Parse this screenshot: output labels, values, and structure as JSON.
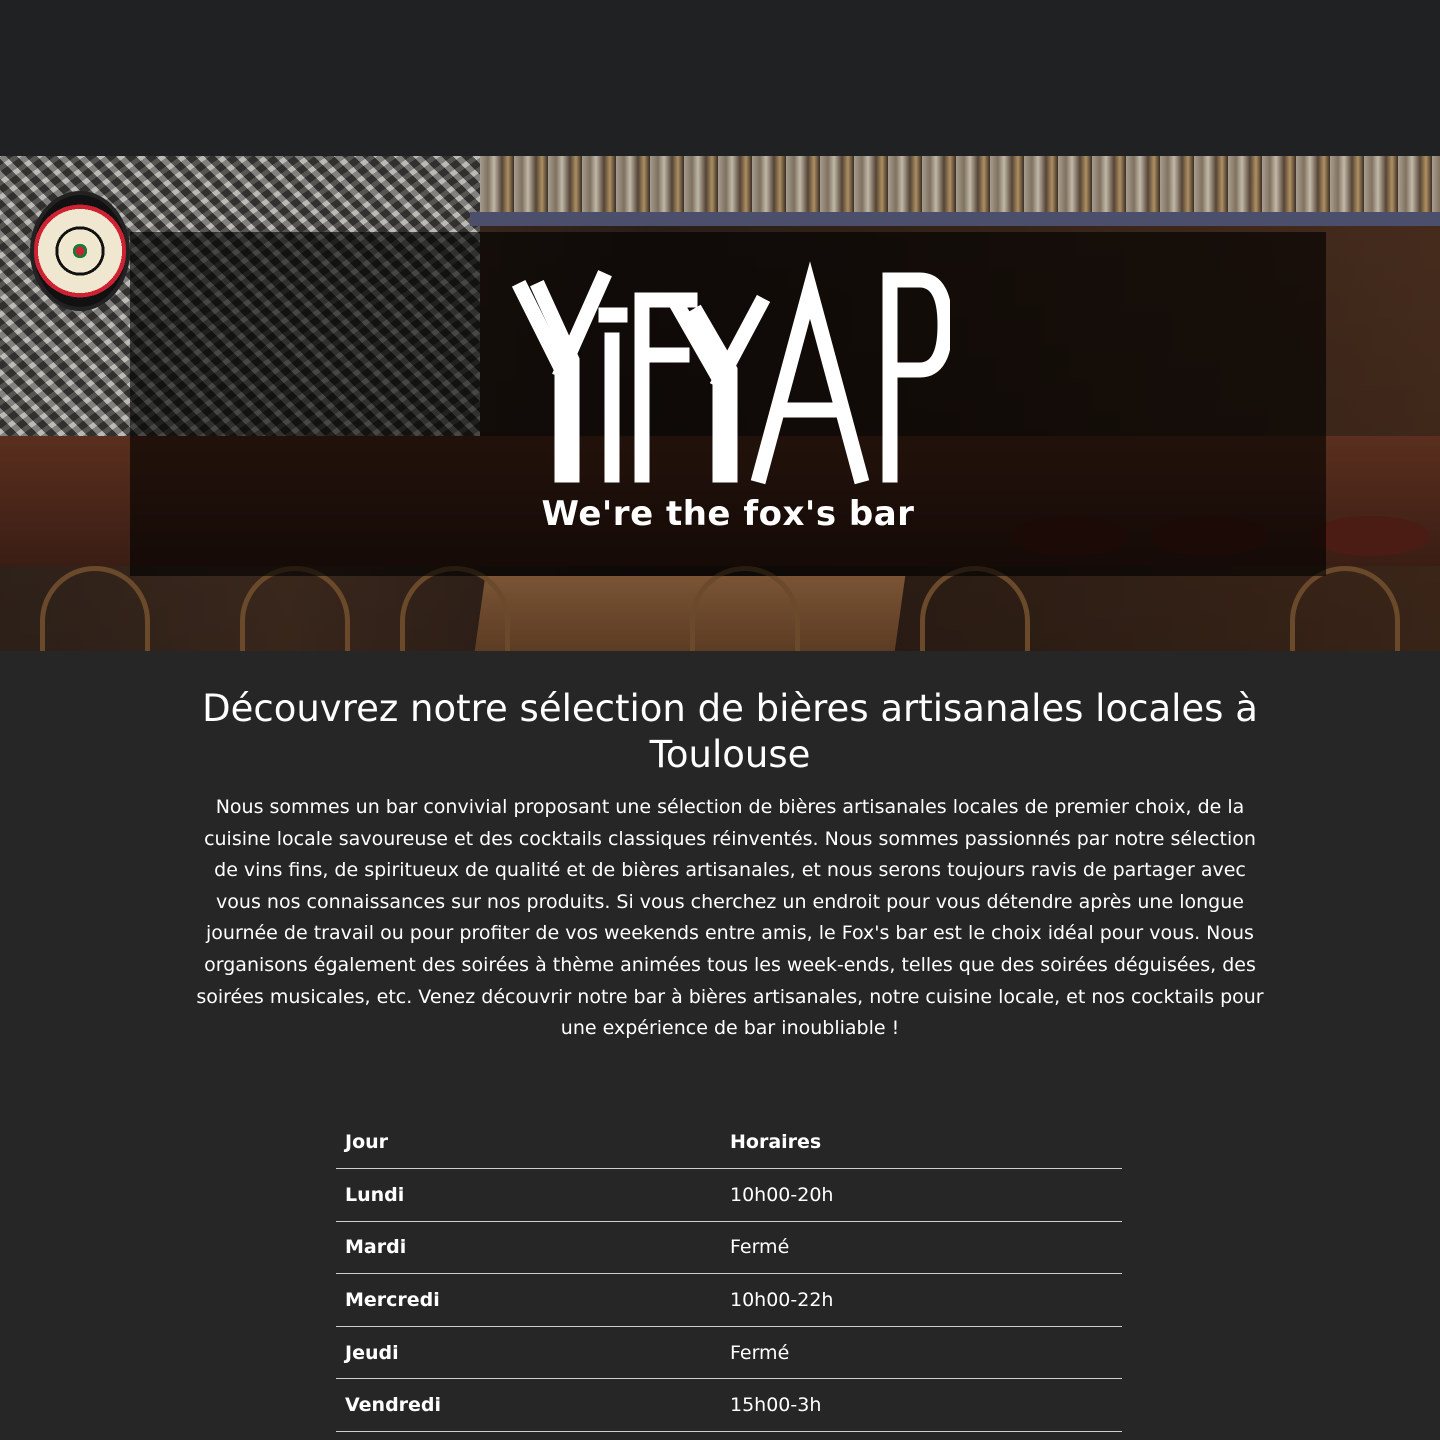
{
  "hero": {
    "logo_text": "YiFYAP",
    "tagline": "We're the fox's bar"
  },
  "intro": {
    "title": "Découvrez notre sélection de bières artisanales locales à Toulouse",
    "body": "Nous sommes un bar convivial proposant une sélection de bières artisanales locales de premier choix, de la cuisine locale savoureuse et des cocktails classiques réinventés. Nous sommes passionnés par notre sélection de vins fins, de spiritueux de qualité et de bières artisanales, et nous serons toujours ravis de partager avec vous nos connaissances sur nos produits. Si vous cherchez un endroit pour vous détendre après une longue journée de travail ou pour profiter de vos weekends entre amis, le Fox's bar est le choix idéal pour vous. Nous organisons également des soirées à thème animées tous les week-ends, telles que des soirées déguisées, des soirées musicales, etc. Venez découvrir notre bar à bières artisanales, notre cuisine locale, et nos cocktails pour une expérience de bar inoubliable !"
  },
  "hours": {
    "headers": [
      "Jour",
      "Horaires"
    ],
    "rows": [
      {
        "day": "Lundi",
        "time": "10h00-20h"
      },
      {
        "day": "Mardi",
        "time": "Fermé"
      },
      {
        "day": "Mercredi",
        "time": "10h00-22h"
      },
      {
        "day": "Jeudi",
        "time": "Fermé"
      },
      {
        "day": "Vendredi",
        "time": "15h00-3h"
      }
    ]
  },
  "colors": {
    "page_background": "#262626",
    "top_bar": "#1f2122",
    "text": "#ffffff",
    "table_rule": "#cfcfcf"
  }
}
